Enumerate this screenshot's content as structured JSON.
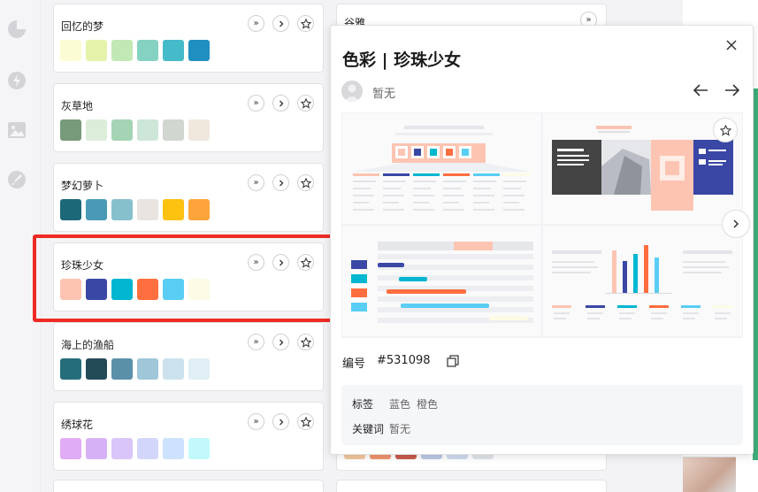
{
  "rail": {
    "icons": [
      "pie-chart-icon",
      "bolt-icon",
      "image-icon",
      "brush-icon"
    ]
  },
  "palettes": [
    {
      "name": "回忆的梦",
      "colors": [
        "#fcfcd4",
        "#e5f3aa",
        "#c2e8b5",
        "#85d2c2",
        "#45bac9",
        "#1f8fc1"
      ]
    },
    {
      "name": "灰草地",
      "colors": [
        "#779a7a",
        "#dcedd9",
        "#a4d4b4",
        "#cde6d8",
        "#d1d6d0",
        "#f0e7dd"
      ]
    },
    {
      "name": "梦幻萝卜",
      "colors": [
        "#1d6878",
        "#4a9ab5",
        "#86c0cd",
        "#e9e4e0",
        "#fdc110",
        "#fda43b"
      ]
    },
    {
      "name": "珍珠少女",
      "colors": [
        "#fec4b2",
        "#3a47a5",
        "#00b6d1",
        "#ff6e3e",
        "#59cdf4",
        "#fcfbe5"
      ]
    },
    {
      "name": "海上的渔船",
      "colors": [
        "#256d7b",
        "#234a57",
        "#5a90a8",
        "#a0c6da",
        "#cbe2ee",
        "#e0eef6"
      ]
    },
    {
      "name": "绣球花",
      "colors": [
        "#e0acf6",
        "#d7b1f5",
        "#d9c5f8",
        "#d3d6fb",
        "#cce2fd",
        "#c1f9fc"
      ]
    }
  ],
  "col2": {
    "top_name": "谷雅"
  },
  "col2bottom_colors": [
    "#f3c79c",
    "#f1956f",
    "#c95c4e",
    "#bac9e4",
    "#cfdcef",
    "#e0e4ea"
  ],
  "detail": {
    "title": "色彩 | 珍珠少女",
    "author": "暂无",
    "code_label": "编号",
    "code": "#531098",
    "tags_label": "标签",
    "tags": [
      "蓝色",
      "橙色"
    ],
    "keywords_label": "关键词",
    "keywords": "暂无"
  },
  "colors": {
    "highlight": "#ee2b24",
    "accent_green": "#3fae7c"
  }
}
